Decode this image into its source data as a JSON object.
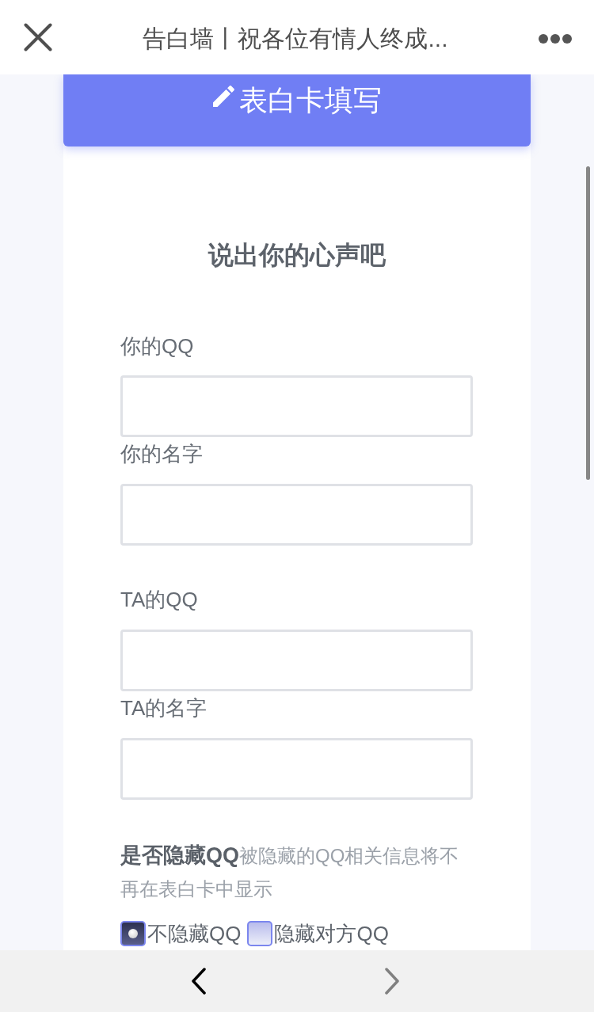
{
  "top_bar": {
    "title": "告白墙丨祝各位有情人终成..."
  },
  "card": {
    "header": "表白卡填写",
    "heading": "说出你的心声吧",
    "fields": [
      {
        "label": "你的QQ"
      },
      {
        "label": "你的名字"
      },
      {
        "label": "TA的QQ"
      },
      {
        "label": "TA的名字"
      }
    ],
    "hide_qq": {
      "description": "**是否隐藏QQ**被隐藏的QQ相关信息将不再在表白卡中显示",
      "options": [
        {
          "label": "不隐藏QQ",
          "selected": true
        },
        {
          "label": "隐藏对方QQ",
          "selected": false
        }
      ]
    }
  },
  "bottom_bar": {
    "buttons": [
      {
        "kind": "back",
        "disabled": false
      },
      {
        "kind": "forward",
        "disabled": true
      }
    ]
  }
}
